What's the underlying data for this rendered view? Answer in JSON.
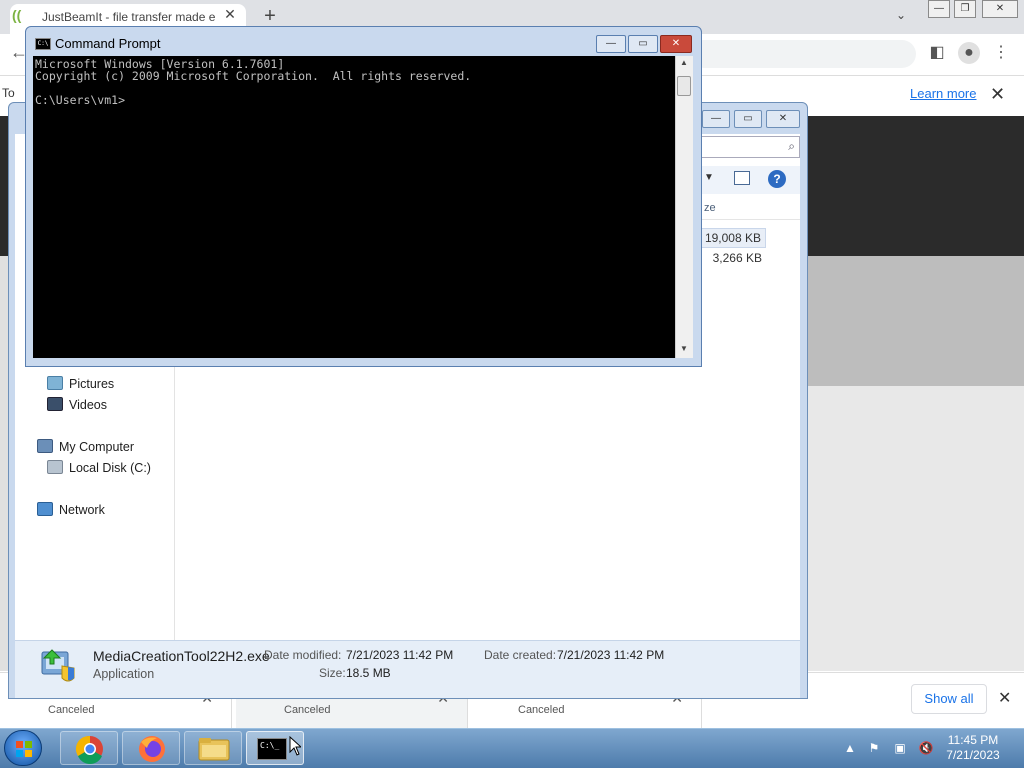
{
  "browser": {
    "tab_title": "JustBeamIt - file transfer made e",
    "tab_close": "✕",
    "new_tab": "+",
    "learn_more": "Learn more",
    "side_text": "To"
  },
  "downloads": {
    "items": [
      {
        "status": "Canceled"
      },
      {
        "status": "Canceled"
      },
      {
        "status": "Canceled"
      }
    ],
    "show_all": "Show all"
  },
  "explorer": {
    "column_header": "ze",
    "sizes": [
      "19,008 KB",
      "3,266 KB"
    ],
    "nav": {
      "pictures": "Pictures",
      "videos": "Videos",
      "my_computer": "My Computer",
      "local_disk": "Local Disk (C:)",
      "network": "Network"
    },
    "details": {
      "name": "MediaCreationTool22H2.exe",
      "type": "Application",
      "date_modified_label": "Date modified:",
      "date_modified": "7/21/2023 11:42 PM",
      "date_created_label": "Date created:",
      "date_created": "7/21/2023 11:42 PM",
      "size_label": "Size:",
      "size": "18.5 MB"
    }
  },
  "cmd": {
    "title": "Command Prompt",
    "icon_text": "C:\\",
    "lines": [
      "Microsoft Windows [Version 6.1.7601]",
      "Copyright (c) 2009 Microsoft Corporation.  All rights reserved.",
      "",
      "C:\\Users\\vm1>"
    ]
  },
  "taskbar": {
    "time": "11:45 PM",
    "date": "7/21/2023",
    "cmd_icon_text": "C:\\_"
  }
}
